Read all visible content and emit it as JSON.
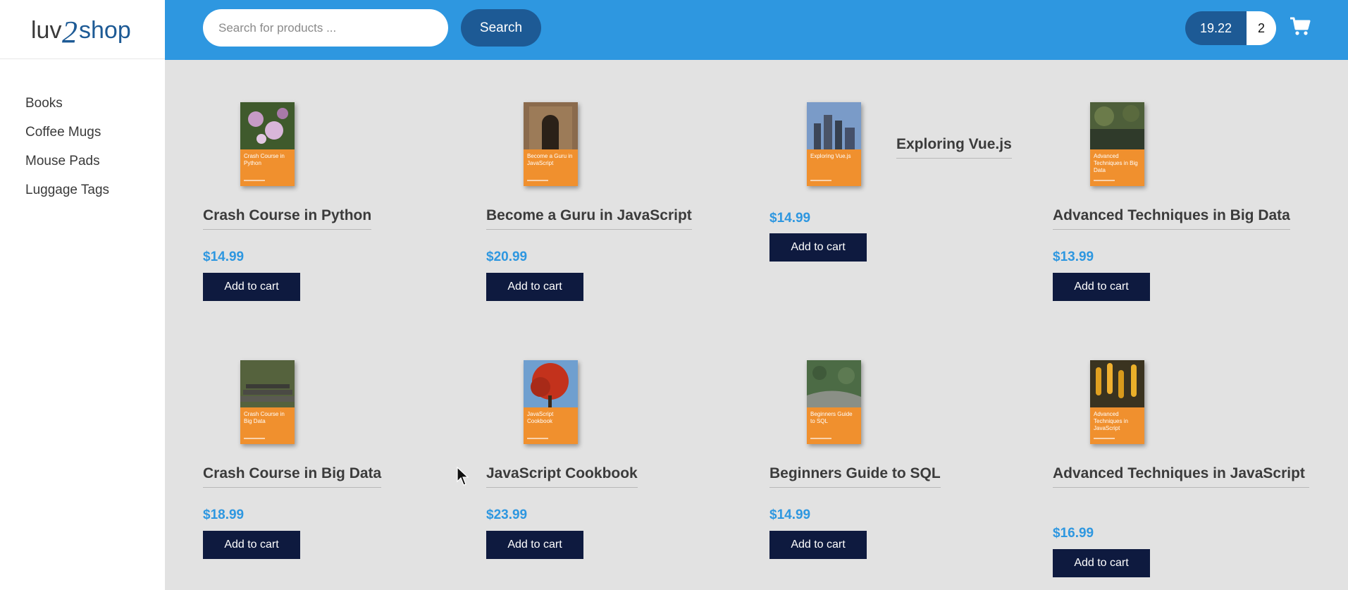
{
  "logo": {
    "text_a": "luv",
    "text_b": "2",
    "text_c": "shop"
  },
  "sidebar": {
    "items": [
      {
        "label": "Books"
      },
      {
        "label": "Coffee Mugs"
      },
      {
        "label": "Mouse Pads"
      },
      {
        "label": "Luggage Tags"
      }
    ]
  },
  "header": {
    "search_placeholder": "Search for products ...",
    "search_label": "Search",
    "cart_total": "19.22",
    "cart_quantity": "2",
    "cart_icon": "shopping-cart-icon"
  },
  "colors": {
    "header_blue": "#2e97e0",
    "dark_blue": "#1d5a95",
    "button_navy": "#0e1a3f",
    "price_blue": "#2e97e0",
    "cover_orange": "#f0902e"
  },
  "products": [
    {
      "name": "Crash Course in Python",
      "price": "$14.99",
      "button": "Add to cart",
      "cover_text": "Crash Course in Python"
    },
    {
      "name": "Become a Guru in JavaScript",
      "price": "$20.99",
      "button": "Add to cart",
      "cover_text": "Become a Guru in JavaScript"
    },
    {
      "name": "Exploring Vue.js",
      "price": "$14.99",
      "button": "Add to cart",
      "cover_text": "Exploring Vue.js"
    },
    {
      "name": "Advanced Techniques in Big Data",
      "price": "$13.99",
      "button": "Add to cart",
      "cover_text": "Advanced Techniques in Big Data"
    },
    {
      "name": "Crash Course in Big Data",
      "price": "$18.99",
      "button": "Add to cart",
      "cover_text": "Crash Course in Big Data"
    },
    {
      "name": "JavaScript Cookbook",
      "price": "$23.99",
      "button": "Add to cart",
      "cover_text": "JavaScript Cookbook"
    },
    {
      "name": "Beginners Guide to SQL",
      "price": "$14.99",
      "button": "Add to cart",
      "cover_text": "Beginners Guide to SQL"
    },
    {
      "name": "Advanced Techniques in JavaScript",
      "price": "$16.99",
      "button": "Add to cart",
      "cover_text": "Advanced Techniques in JavaScript"
    }
  ]
}
